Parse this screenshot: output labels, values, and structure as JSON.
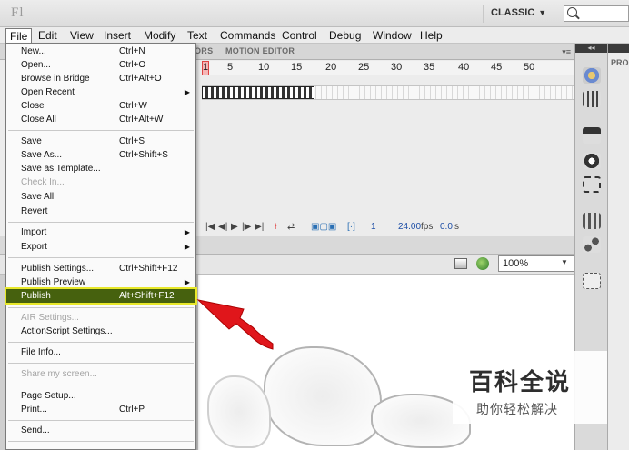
{
  "app": {
    "logo": "Fl",
    "workspace": "CLASSIC"
  },
  "menubar": [
    "File",
    "Edit",
    "View",
    "Insert",
    "Modify",
    "Text",
    "Commands",
    "Control",
    "Debug",
    "Window",
    "Help"
  ],
  "timeline": {
    "tabs": [
      "ORS",
      "MOTION EDITOR"
    ],
    "ruler_ticks": [
      "1",
      "5",
      "10",
      "15",
      "20",
      "25",
      "30",
      "35",
      "40",
      "45",
      "50"
    ],
    "current_frame": "1",
    "fps": "24.00",
    "fps_unit": "fps",
    "time": "0.0",
    "time_unit": "s"
  },
  "stage": {
    "zoom": "100%"
  },
  "file_menu": {
    "items": [
      {
        "label": "New...",
        "shortcut": "Ctrl+N"
      },
      {
        "label": "Open...",
        "shortcut": "Ctrl+O"
      },
      {
        "label": "Browse in Bridge",
        "shortcut": "Ctrl+Alt+O"
      },
      {
        "label": "Open Recent",
        "shortcut": "",
        "submenu": true
      },
      {
        "label": "Close",
        "shortcut": "Ctrl+W"
      },
      {
        "label": "Close All",
        "shortcut": "Ctrl+Alt+W"
      },
      {
        "label": "Save",
        "shortcut": "Ctrl+S"
      },
      {
        "label": "Save As...",
        "shortcut": "Ctrl+Shift+S"
      },
      {
        "label": "Save as Template...",
        "shortcut": ""
      },
      {
        "label": "Check In...",
        "shortcut": "",
        "disabled": true
      },
      {
        "label": "Save All",
        "shortcut": ""
      },
      {
        "label": "Revert",
        "shortcut": ""
      },
      {
        "label": "Import",
        "shortcut": "",
        "submenu": true
      },
      {
        "label": "Export",
        "shortcut": "",
        "submenu": true
      },
      {
        "label": "Publish Settings...",
        "shortcut": "Ctrl+Shift+F12"
      },
      {
        "label": "Publish Preview",
        "shortcut": "",
        "submenu": true
      },
      {
        "label": "Publish",
        "shortcut": "Alt+Shift+F12",
        "highlight": true
      },
      {
        "label": "AIR Settings...",
        "shortcut": "",
        "disabled": true
      },
      {
        "label": "ActionScript Settings...",
        "shortcut": ""
      },
      {
        "label": "File Info...",
        "shortcut": ""
      },
      {
        "label": "Share my screen...",
        "shortcut": "",
        "disabled": true
      },
      {
        "label": "Page Setup...",
        "shortcut": ""
      },
      {
        "label": "Print...",
        "shortcut": "Ctrl+P"
      },
      {
        "label": "Send...",
        "shortcut": ""
      }
    ]
  },
  "properties": {
    "header": "PRO"
  },
  "watermark": {
    "title": "百科全说",
    "subtitle": "助你轻松解决"
  },
  "colors": {
    "highlight_bg": "#46610e",
    "highlight_outline": "#e8e82a",
    "arrow": "#e0161b",
    "playhead": "#e03030"
  }
}
